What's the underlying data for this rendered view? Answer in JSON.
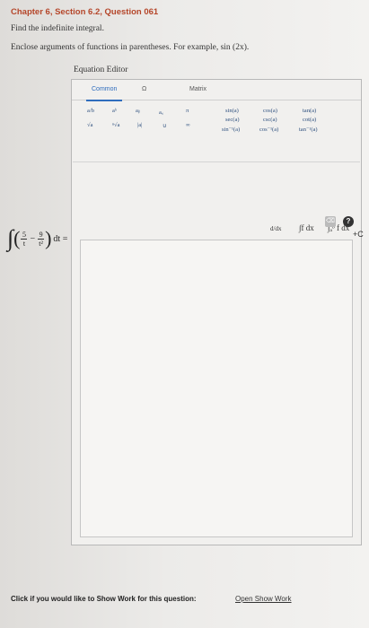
{
  "header": "Chapter 6, Section 6.2, Question 061",
  "instructions": {
    "line1": "Find the indefinite integral.",
    "line2": "Enclose arguments of functions in parentheses. For example, sin (2x)."
  },
  "problem": {
    "integral_sign": "∫",
    "open_paren": "(",
    "t1_num": "5",
    "t1_den": "t",
    "minus": "−",
    "t2_num": "9",
    "t2_den": "t²",
    "close_paren": ")",
    "dt": "dt =",
    "plus_c": "+C"
  },
  "editor": {
    "title": "Equation Editor",
    "tabs": [
      {
        "label": "Common"
      },
      {
        "label": "Ω"
      },
      {
        "label": "Matrix"
      }
    ],
    "palette": {
      "frac": "a/b",
      "power": "aᵇ",
      "sub": "aᵦ",
      "sqrt": "√a",
      "nroot": "ⁿ√a",
      "abs": "|a|",
      "pi": "π",
      "union": "∪",
      "infinity": "∞",
      "sin": "sin(a)",
      "sec": "sec(a)",
      "asin": "sin⁻¹(a)",
      "cos": "cos(a)",
      "csc": "csc(a)",
      "acos": "cos⁻¹(a)",
      "tan": "tan(a)",
      "cot": "cot(a)",
      "atan": "tan⁻¹(a)",
      "deriv": "d/dx",
      "sub2": "a꜀"
    },
    "toolbar": {
      "integral": "∫f dx",
      "def_integral": "∫ₐᵇ f dx",
      "clear": "⌫",
      "help": "?"
    }
  },
  "footer": {
    "prompt": "Click if you would like to Show Work for this question:",
    "link": "Open Show Work"
  }
}
